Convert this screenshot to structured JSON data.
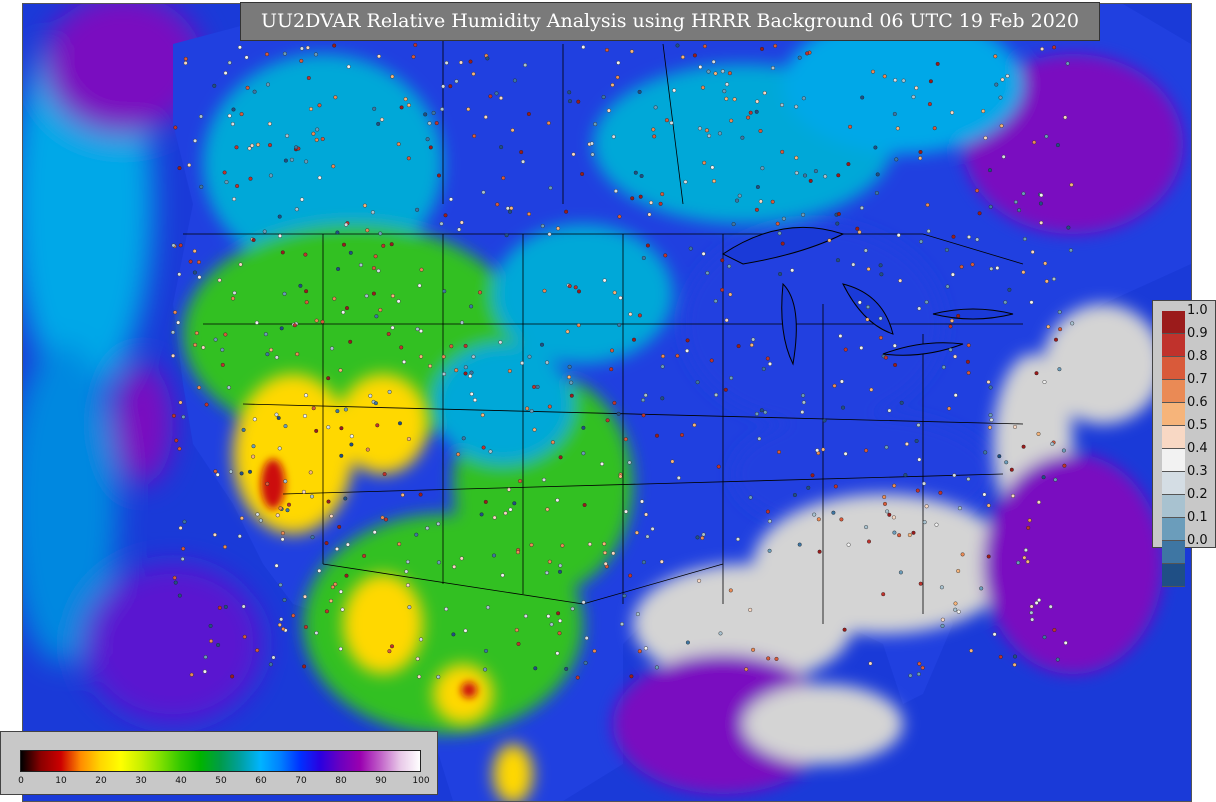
{
  "title": "UU2DVAR Relative Humidity Analysis using HRRR Background 06 UTC 19 Feb 2020",
  "legends": {
    "observation_scale": {
      "labels": [
        "1.0",
        "0.9",
        "0.8",
        "0.7",
        "0.6",
        "0.5",
        "0.4",
        "0.3",
        "0.2",
        "0.1",
        "0.0"
      ],
      "colors": [
        "#9b1b1b",
        "#c0322c",
        "#d95a3a",
        "#ea8a55",
        "#f6b47a",
        "#f8d8c4",
        "#f2f2f2",
        "#d4dde4",
        "#a8c2d0",
        "#6b9dbb",
        "#3e76a3",
        "#1f4f85"
      ]
    },
    "rh_scale": {
      "ticks": [
        "0",
        "10",
        "20",
        "30",
        "40",
        "50",
        "60",
        "70",
        "80",
        "90",
        "100"
      ],
      "colors": [
        "#000000",
        "#8b0000",
        "#cc0000",
        "#ff8c00",
        "#ffd700",
        "#ffff00",
        "#c8f000",
        "#7fe000",
        "#33c800",
        "#00b400",
        "#009b4a",
        "#00a0a0",
        "#00b4ff",
        "#0080ff",
        "#0030ff",
        "#2a00e0",
        "#6a00c0",
        "#9a00b0",
        "#c060c8",
        "#e8c8e8",
        "#ffffff"
      ]
    }
  },
  "map": {
    "ocean_color": "#1a3ad8",
    "land_color": "#2040e0",
    "region_colors": {
      "dry_core": "#cc1010",
      "dry": "#ffd800",
      "moderate": "#30c020",
      "moist": "#00a8d8",
      "humid": "#7a10c0",
      "saturated": "#d4d4d4"
    }
  }
}
